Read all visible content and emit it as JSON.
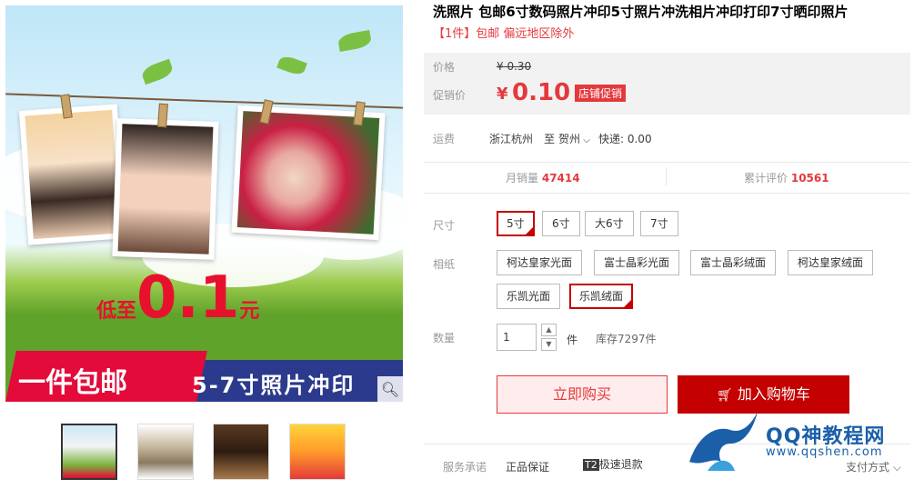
{
  "product": {
    "title": "洗照片 包邮6寸数码照片冲印5寸照片冲洗相片冲印打印7寸晒印照片",
    "subtitle": "【1件】包邮 偏远地区除外"
  },
  "main_image": {
    "promo_prefix": "低至",
    "promo_value": "0.1",
    "promo_suffix": "元",
    "banner_left": "一件包邮",
    "banner_right": "5-7寸照片冲印"
  },
  "price": {
    "original_label": "价格",
    "original_value": "¥ 0.30",
    "promo_label": "促销价",
    "currency": "¥",
    "promo_value": "0.10",
    "promo_tag": "店铺促销"
  },
  "shipping": {
    "label": "运费",
    "from": "浙江杭州",
    "to_word": "至",
    "dest": "贺州",
    "method": "快递: 0.00"
  },
  "stats": {
    "sales_label": "月销量",
    "sales_value": "47414",
    "reviews_label": "累计评价",
    "reviews_value": "10561"
  },
  "size": {
    "label": "尺寸",
    "options": [
      "5寸",
      "6寸",
      "大6寸",
      "7寸"
    ],
    "selected": "5寸"
  },
  "paper": {
    "label": "相纸",
    "options": [
      "柯达皇家光面",
      "富士晶彩光面",
      "富士晶彩绒面",
      "柯达皇家绒面",
      "乐凯光面",
      "乐凯绒面"
    ],
    "selected": "乐凯绒面"
  },
  "quantity": {
    "label": "数量",
    "value": "1",
    "unit": "件",
    "stock": "库存7297件"
  },
  "actions": {
    "buy_now": "立即购买",
    "add_cart": "加入购物车"
  },
  "service": {
    "label": "服务承诺",
    "items": [
      "正品保证",
      "极速退款"
    ],
    "badge": "T2",
    "payment": "支付方式"
  },
  "watermark": {
    "title": "QQ神教程网",
    "url": "www.qqshen.com"
  },
  "colors": {
    "accent": "#e4393c",
    "cart": "#c40000"
  }
}
